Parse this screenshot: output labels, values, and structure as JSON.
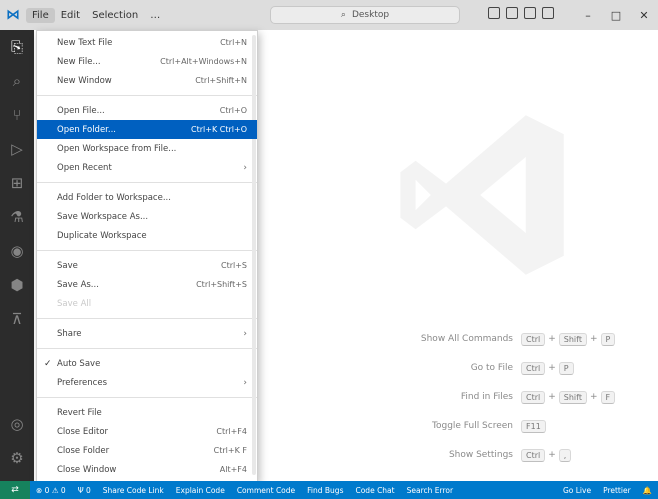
{
  "titlebar": {
    "menus": [
      "File",
      "Edit",
      "Selection",
      "…"
    ],
    "search_label": "Desktop",
    "controls": [
      "–",
      "□",
      "✕"
    ]
  },
  "activity_bar": {
    "icons": [
      "files-icon",
      "search-icon",
      "source-control-icon",
      "run-debug-icon",
      "extensions-icon",
      "testing-icon",
      "remote-explorer-icon",
      "docker-icon",
      "deploy-icon"
    ],
    "bottom_icons": [
      "account-icon",
      "manage-icon"
    ]
  },
  "file_menu": {
    "groups": [
      [
        {
          "label": "New Text File",
          "shortcut": "Ctrl+N"
        },
        {
          "label": "New File...",
          "shortcut": "Ctrl+Alt+Windows+N"
        },
        {
          "label": "New Window",
          "shortcut": "Ctrl+Shift+N"
        }
      ],
      [
        {
          "label": "Open File...",
          "shortcut": "Ctrl+O"
        },
        {
          "label": "Open Folder...",
          "shortcut": "Ctrl+K Ctrl+O",
          "highlight": true
        },
        {
          "label": "Open Workspace from File...",
          "shortcut": ""
        },
        {
          "label": "Open Recent",
          "shortcut": "",
          "submenu": true
        }
      ],
      [
        {
          "label": "Add Folder to Workspace...",
          "shortcut": ""
        },
        {
          "label": "Save Workspace As...",
          "shortcut": ""
        },
        {
          "label": "Duplicate Workspace",
          "shortcut": ""
        }
      ],
      [
        {
          "label": "Save",
          "shortcut": "Ctrl+S"
        },
        {
          "label": "Save As...",
          "shortcut": "Ctrl+Shift+S"
        },
        {
          "label": "Save All",
          "shortcut": "",
          "disabled": true
        }
      ],
      [
        {
          "label": "Share",
          "shortcut": "",
          "submenu": true
        }
      ],
      [
        {
          "label": "Auto Save",
          "shortcut": "",
          "checked": true
        },
        {
          "label": "Preferences",
          "shortcut": "",
          "submenu": true
        }
      ],
      [
        {
          "label": "Revert File",
          "shortcut": ""
        },
        {
          "label": "Close Editor",
          "shortcut": "Ctrl+F4"
        },
        {
          "label": "Close Folder",
          "shortcut": "Ctrl+K F"
        },
        {
          "label": "Close Window",
          "shortcut": "Alt+F4"
        }
      ]
    ]
  },
  "welcome": {
    "shortcuts": [
      {
        "label": "Show All Commands",
        "keys": [
          "Ctrl",
          "+",
          "Shift",
          "+",
          "P"
        ]
      },
      {
        "label": "Go to File",
        "keys": [
          "Ctrl",
          "+",
          "P"
        ]
      },
      {
        "label": "Find in Files",
        "keys": [
          "Ctrl",
          "+",
          "Shift",
          "+",
          "F"
        ]
      },
      {
        "label": "Toggle Full Screen",
        "keys": [
          "F11"
        ]
      },
      {
        "label": "Show Settings",
        "keys": [
          "Ctrl",
          "+",
          ","
        ]
      }
    ]
  },
  "statusbar": {
    "remote": "⇄",
    "items": [
      "⊗ 0 ⚠ 0",
      "Ψ 0",
      "Share Code Link",
      "Explain Code",
      "Comment Code",
      "Find Bugs",
      "Code Chat",
      "Search Error"
    ],
    "right_items": [
      "Go Live",
      "Prettier",
      "🔔"
    ]
  },
  "colors": {
    "accent": "#0060c0",
    "statusbar": "#007acc",
    "activity": "#2c2c2c"
  }
}
